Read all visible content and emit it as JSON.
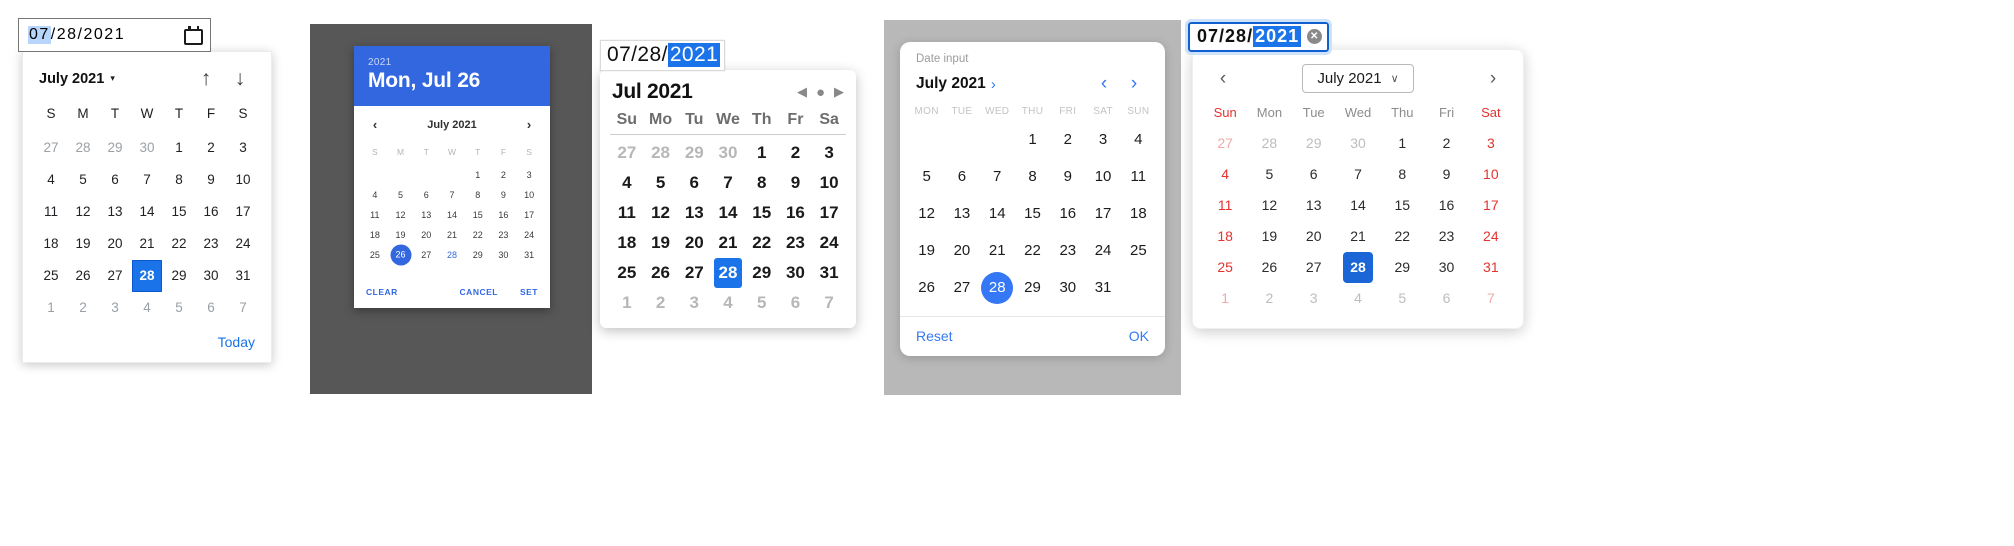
{
  "chrome": {
    "input": {
      "month": "07",
      "sep": "/",
      "day": "28",
      "year": "2021",
      "selected_segment": "07"
    },
    "icon": "calendar-icon",
    "header": {
      "month_label": "July 2021",
      "caret": "▾",
      "prev_arrow": "↑",
      "next_arrow": "↓"
    },
    "dow": [
      "S",
      "M",
      "T",
      "W",
      "T",
      "F",
      "S"
    ],
    "weeks": [
      [
        {
          "d": "27",
          "m": true
        },
        {
          "d": "28",
          "m": true
        },
        {
          "d": "29",
          "m": true
        },
        {
          "d": "30",
          "m": true
        },
        {
          "d": "1"
        },
        {
          "d": "2"
        },
        {
          "d": "3"
        }
      ],
      [
        {
          "d": "4"
        },
        {
          "d": "5"
        },
        {
          "d": "6"
        },
        {
          "d": "7"
        },
        {
          "d": "8"
        },
        {
          "d": "9"
        },
        {
          "d": "10"
        }
      ],
      [
        {
          "d": "11"
        },
        {
          "d": "12"
        },
        {
          "d": "13"
        },
        {
          "d": "14"
        },
        {
          "d": "15"
        },
        {
          "d": "16"
        },
        {
          "d": "17"
        }
      ],
      [
        {
          "d": "18"
        },
        {
          "d": "19"
        },
        {
          "d": "20"
        },
        {
          "d": "21"
        },
        {
          "d": "22"
        },
        {
          "d": "23"
        },
        {
          "d": "24"
        }
      ],
      [
        {
          "d": "25"
        },
        {
          "d": "26"
        },
        {
          "d": "27"
        },
        {
          "d": "28",
          "s": true
        },
        {
          "d": "29"
        },
        {
          "d": "30"
        },
        {
          "d": "31"
        }
      ],
      [
        {
          "d": "1",
          "m": true
        },
        {
          "d": "2",
          "m": true
        },
        {
          "d": "3",
          "m": true
        },
        {
          "d": "4",
          "m": true
        },
        {
          "d": "5",
          "m": true
        },
        {
          "d": "6",
          "m": true
        },
        {
          "d": "7",
          "m": true
        }
      ]
    ],
    "today_label": "Today",
    "accent": "#1a73e8"
  },
  "material": {
    "header": {
      "year": "2021",
      "date": "Mon, Jul 26"
    },
    "nav": {
      "prev": "‹",
      "label": "July 2021",
      "next": "›"
    },
    "dow": [
      "S",
      "M",
      "T",
      "W",
      "T",
      "F",
      "S"
    ],
    "weeks": [
      [
        {
          "d": ""
        },
        {
          "d": ""
        },
        {
          "d": ""
        },
        {
          "d": ""
        },
        {
          "d": "1"
        },
        {
          "d": "2"
        },
        {
          "d": "3"
        }
      ],
      [
        {
          "d": "4"
        },
        {
          "d": "5"
        },
        {
          "d": "6"
        },
        {
          "d": "7"
        },
        {
          "d": "8"
        },
        {
          "d": "9"
        },
        {
          "d": "10"
        }
      ],
      [
        {
          "d": "11"
        },
        {
          "d": "12"
        },
        {
          "d": "13"
        },
        {
          "d": "14"
        },
        {
          "d": "15"
        },
        {
          "d": "16"
        },
        {
          "d": "17"
        }
      ],
      [
        {
          "d": "18"
        },
        {
          "d": "19"
        },
        {
          "d": "20"
        },
        {
          "d": "21"
        },
        {
          "d": "22"
        },
        {
          "d": "23"
        },
        {
          "d": "24"
        }
      ],
      [
        {
          "d": "25"
        },
        {
          "d": "26",
          "s": true
        },
        {
          "d": "27"
        },
        {
          "d": "28",
          "t": true
        },
        {
          "d": "29"
        },
        {
          "d": "30"
        },
        {
          "d": "31"
        }
      ]
    ],
    "actions": {
      "clear": "CLEAR",
      "cancel": "CANCEL",
      "set": "SET"
    },
    "accent": "#3367e0"
  },
  "safari": {
    "input": {
      "month": "07",
      "sep": "/",
      "day": "28",
      "year": "2021",
      "selected_segment": "2021"
    },
    "header": {
      "title": "Jul 2021",
      "prev": "◀",
      "dot": "●",
      "next": "▶"
    },
    "dow": [
      "Su",
      "Mo",
      "Tu",
      "We",
      "Th",
      "Fr",
      "Sa"
    ],
    "weeks": [
      [
        {
          "d": "27",
          "m": true
        },
        {
          "d": "28",
          "m": true
        },
        {
          "d": "29",
          "m": true
        },
        {
          "d": "30",
          "m": true
        },
        {
          "d": "1"
        },
        {
          "d": "2"
        },
        {
          "d": "3"
        }
      ],
      [
        {
          "d": "4"
        },
        {
          "d": "5"
        },
        {
          "d": "6"
        },
        {
          "d": "7"
        },
        {
          "d": "8"
        },
        {
          "d": "9"
        },
        {
          "d": "10"
        }
      ],
      [
        {
          "d": "11"
        },
        {
          "d": "12"
        },
        {
          "d": "13"
        },
        {
          "d": "14"
        },
        {
          "d": "15"
        },
        {
          "d": "16"
        },
        {
          "d": "17"
        }
      ],
      [
        {
          "d": "18"
        },
        {
          "d": "19"
        },
        {
          "d": "20"
        },
        {
          "d": "21"
        },
        {
          "d": "22"
        },
        {
          "d": "23"
        },
        {
          "d": "24"
        }
      ],
      [
        {
          "d": "25"
        },
        {
          "d": "26"
        },
        {
          "d": "27"
        },
        {
          "d": "28",
          "s": true
        },
        {
          "d": "29"
        },
        {
          "d": "30"
        },
        {
          "d": "31"
        }
      ],
      [
        {
          "d": "1",
          "m": true
        },
        {
          "d": "2",
          "m": true
        },
        {
          "d": "3",
          "m": true
        },
        {
          "d": "4",
          "m": true
        },
        {
          "d": "5",
          "m": true
        },
        {
          "d": "6",
          "m": true
        },
        {
          "d": "7",
          "m": true
        }
      ]
    ],
    "accent": "#1a73e8"
  },
  "ios": {
    "label": "Date input",
    "nav": {
      "month_label": "July 2021",
      "month_chevron": "›",
      "prev": "‹",
      "next": "›"
    },
    "dow": [
      "MON",
      "TUE",
      "WED",
      "THU",
      "FRI",
      "SAT",
      "SUN"
    ],
    "weeks": [
      [
        {
          "d": ""
        },
        {
          "d": ""
        },
        {
          "d": ""
        },
        {
          "d": "1"
        },
        {
          "d": "2"
        },
        {
          "d": "3"
        },
        {
          "d": "4"
        }
      ],
      [
        {
          "d": "5"
        },
        {
          "d": "6"
        },
        {
          "d": "7"
        },
        {
          "d": "8"
        },
        {
          "d": "9"
        },
        {
          "d": "10"
        },
        {
          "d": "11"
        }
      ],
      [
        {
          "d": "12"
        },
        {
          "d": "13"
        },
        {
          "d": "14"
        },
        {
          "d": "15"
        },
        {
          "d": "16"
        },
        {
          "d": "17"
        },
        {
          "d": "18"
        }
      ],
      [
        {
          "d": "19"
        },
        {
          "d": "20"
        },
        {
          "d": "21"
        },
        {
          "d": "22"
        },
        {
          "d": "23"
        },
        {
          "d": "24"
        },
        {
          "d": "25"
        }
      ],
      [
        {
          "d": "26"
        },
        {
          "d": "27"
        },
        {
          "d": "28",
          "s": true
        },
        {
          "d": "29"
        },
        {
          "d": "30"
        },
        {
          "d": "31"
        },
        {
          "d": ""
        }
      ]
    ],
    "footer": {
      "reset": "Reset",
      "ok": "OK"
    },
    "accent": "#3478f6"
  },
  "edge": {
    "input": {
      "month": "07",
      "sep": "/",
      "day": "28",
      "year": "2021",
      "selected_segment": "2021",
      "clear_icon": "✕"
    },
    "header": {
      "prev": "‹",
      "month_label": "July 2021",
      "chevron": "∨",
      "next": "›"
    },
    "dow": [
      "Sun",
      "Mon",
      "Tue",
      "Wed",
      "Thu",
      "Fri",
      "Sat"
    ],
    "weeks": [
      [
        {
          "d": "27",
          "m": true,
          "w": true
        },
        {
          "d": "28",
          "m": true
        },
        {
          "d": "29",
          "m": true
        },
        {
          "d": "30",
          "m": true
        },
        {
          "d": "1"
        },
        {
          "d": "2"
        },
        {
          "d": "3",
          "w": true
        }
      ],
      [
        {
          "d": "4",
          "w": true
        },
        {
          "d": "5"
        },
        {
          "d": "6"
        },
        {
          "d": "7"
        },
        {
          "d": "8"
        },
        {
          "d": "9"
        },
        {
          "d": "10",
          "w": true
        }
      ],
      [
        {
          "d": "11",
          "w": true
        },
        {
          "d": "12"
        },
        {
          "d": "13"
        },
        {
          "d": "14"
        },
        {
          "d": "15"
        },
        {
          "d": "16"
        },
        {
          "d": "17",
          "w": true
        }
      ],
      [
        {
          "d": "18",
          "w": true
        },
        {
          "d": "19"
        },
        {
          "d": "20"
        },
        {
          "d": "21"
        },
        {
          "d": "22"
        },
        {
          "d": "23"
        },
        {
          "d": "24",
          "w": true
        }
      ],
      [
        {
          "d": "25",
          "w": true
        },
        {
          "d": "26"
        },
        {
          "d": "27"
        },
        {
          "d": "28",
          "s": true
        },
        {
          "d": "29"
        },
        {
          "d": "30"
        },
        {
          "d": "31",
          "w": true
        }
      ],
      [
        {
          "d": "1",
          "m": true,
          "w": true
        },
        {
          "d": "2",
          "m": true
        },
        {
          "d": "3",
          "m": true
        },
        {
          "d": "4",
          "m": true
        },
        {
          "d": "5",
          "m": true
        },
        {
          "d": "6",
          "m": true
        },
        {
          "d": "7",
          "m": true,
          "w": true
        }
      ]
    ],
    "accent": "#1a66d6",
    "weekend_color": "#e3342f"
  }
}
